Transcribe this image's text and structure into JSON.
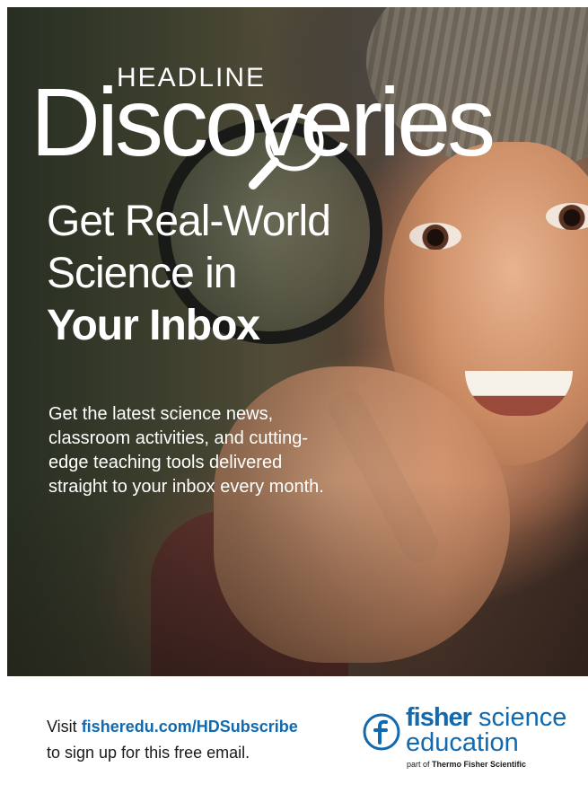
{
  "header": {
    "kicker": "HEADLINE",
    "title": "Discoveries"
  },
  "hero": {
    "tagline_line1": "Get Real-World",
    "tagline_line2": "Science in",
    "tagline_line3": "Your Inbox",
    "body": "Get the latest science news, classroom activities, and cutting-edge teaching tools delivered straight to your inbox every month."
  },
  "footer": {
    "visit_prefix": "Visit ",
    "visit_url": "fisheredu.com/HDSubscribe",
    "visit_suffix": "to sign up for this free email.",
    "brand_bold": "fisher",
    "brand_light": "science",
    "brand_line2": "education",
    "parent_prefix": "part of ",
    "parent_name": "Thermo Fisher Scientific"
  },
  "colors": {
    "brand_blue": "#1169b0",
    "text_dark": "#1a1a1a",
    "headline_white": "#ffffff"
  },
  "icons": {
    "title_o": "search-icon",
    "brand_mark": "fisher-f-logo-icon"
  }
}
